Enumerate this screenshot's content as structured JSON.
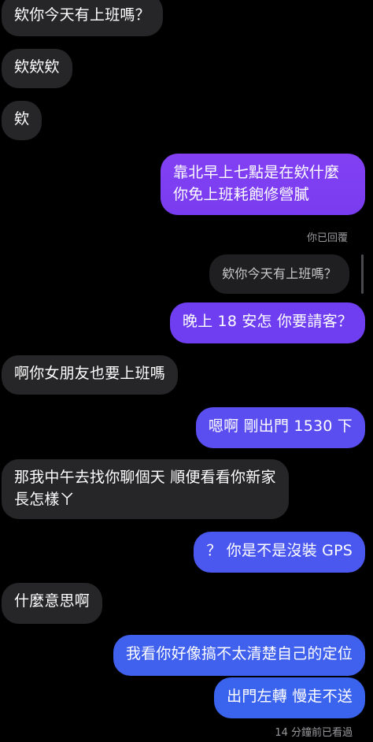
{
  "messages": {
    "m1": "欸你今天有上班嗎？",
    "m2": "欸欸欸",
    "m3": "欸",
    "m4_line1": "靠北早上七點是在欸什麼",
    "m4_line2": "你免上班耗飽修營膩",
    "reply_label": "你已回覆",
    "reply_quote": "欸你今天有上班嗎？",
    "m5": "晚上 18 安怎 你要請客？",
    "m6": "啊你女朋友也要上班嗎",
    "m7": "嗯啊 剛出門 1530 下",
    "m8_line1": "那我中午去找你聊個天 順便看看你新家",
    "m8_line2": "長怎樣ㄚ",
    "m9": "？ 你是不是沒裝 GPS",
    "m10": "什麼意思啊",
    "m11": "我看你好像搞不太清楚自己的定位",
    "m12": "出門左轉 慢走不送"
  },
  "status": {
    "seen": "14 分鐘前已看過"
  },
  "colors": {
    "background": "#000000",
    "incoming_bubble": "#262628",
    "outgoing_purple": "#7a3cf0",
    "outgoing_indigo": "#5a4ef0",
    "outgoing_blue": "#3f63ee",
    "meta_text": "#9a9a9e"
  }
}
